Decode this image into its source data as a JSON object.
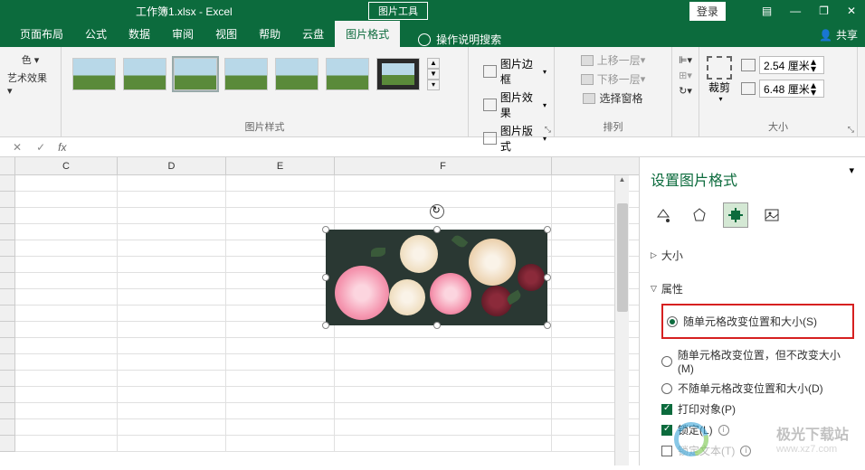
{
  "titlebar": {
    "filename": "工作簿1.xlsx",
    "app": "Excel",
    "context_tool": "图片工具",
    "login": "登录"
  },
  "tabs": {
    "items": [
      "页面布局",
      "公式",
      "数据",
      "审阅",
      "视图",
      "帮助",
      "云盘",
      "图片格式"
    ],
    "active": "图片格式",
    "tell_me": "操作说明搜索",
    "share": "共享"
  },
  "ribbon": {
    "adjust": {
      "color": "色 ▾",
      "effects": "艺术效果 ▾"
    },
    "styles_label": "图片样式",
    "pic_border": "图片边框",
    "pic_effects": "图片效果",
    "pic_layout": "图片版式",
    "arrange": {
      "bring_forward": "上移一层",
      "send_backward": "下移一层",
      "selection_pane": "选择窗格",
      "label": "排列"
    },
    "size": {
      "crop": "裁剪",
      "height": "2.54 厘米",
      "width": "6.48 厘米",
      "label": "大小"
    }
  },
  "columns": [
    "C",
    "D",
    "E",
    "F"
  ],
  "task_pane": {
    "title": "设置图片格式",
    "section_size": "大小",
    "section_props": "属性",
    "opt_move_size": "随单元格改变位置和大小(S)",
    "opt_move_nosize": "随单元格改变位置，但不改变大小(M)",
    "opt_nomove_nosize": "不随单元格改变位置和大小(D)",
    "print": "打印对象(P)",
    "locked": "锁定(L)",
    "lock_text": "锁定文本(T)"
  },
  "watermark": {
    "name": "极光下载站",
    "url": "www.xz7.com"
  }
}
